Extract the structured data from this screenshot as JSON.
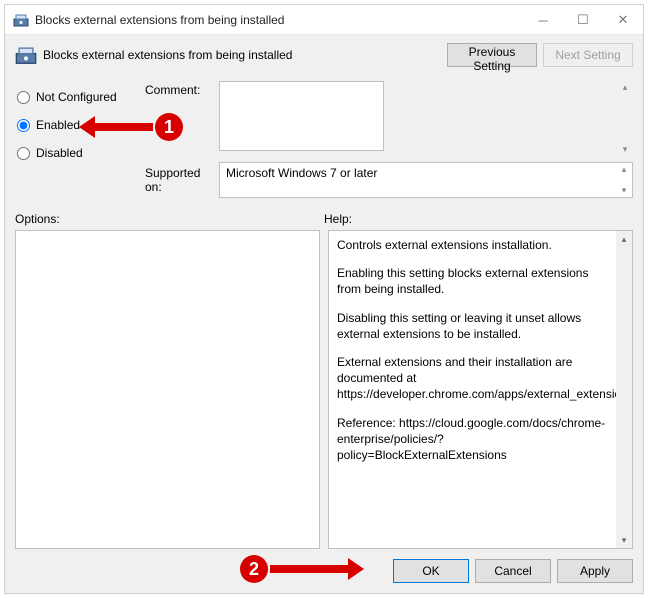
{
  "window": {
    "title": "Blocks external extensions from being installed"
  },
  "header": {
    "policy_title": "Blocks external extensions from being installed",
    "prev_label": "Previous Setting",
    "next_label": "Next Setting"
  },
  "state_options": {
    "not_configured": "Not Configured",
    "enabled": "Enabled",
    "disabled": "Disabled",
    "selected": "enabled"
  },
  "fields": {
    "comment_label": "Comment:",
    "comment_value": "",
    "supported_label": "Supported on:",
    "supported_value": "Microsoft Windows 7 or later"
  },
  "panes": {
    "options_label": "Options:",
    "help_label": "Help:",
    "help_paragraphs": [
      "Controls external extensions installation.",
      "Enabling this setting blocks external extensions from being installed.",
      "Disabling this setting or leaving it unset allows external extensions to be installed.",
      "External extensions and their installation are documented at https://developer.chrome.com/apps/external_extensions.",
      "",
      "Reference: https://cloud.google.com/docs/chrome-enterprise/policies/?policy=BlockExternalExtensions"
    ]
  },
  "buttons": {
    "ok": "OK",
    "cancel": "Cancel",
    "apply": "Apply"
  },
  "annotations": {
    "one": "1",
    "two": "2"
  }
}
